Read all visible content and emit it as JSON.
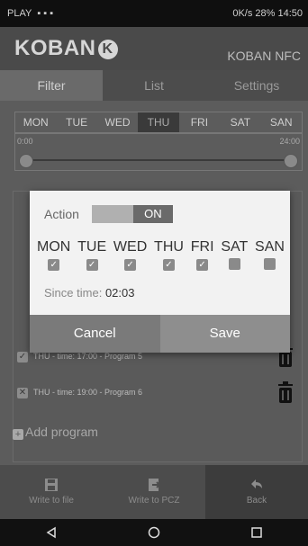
{
  "status": {
    "left_text": "PLAY",
    "right_text": "0K/s  28%  14:50"
  },
  "header": {
    "logo": "KOBAN",
    "logo_mark": "K",
    "brand": "KOBAN NFC"
  },
  "tabs": [
    {
      "label": "Filter"
    },
    {
      "label": "List"
    },
    {
      "label": "Settings"
    }
  ],
  "background": {
    "days": [
      "MON",
      "TUE",
      "WED",
      "THU",
      "FRI",
      "SAT",
      "SAN"
    ],
    "selected_day": "THU",
    "slider": {
      "start": "0:00",
      "end": "24:00"
    },
    "rows": [
      {
        "text": "THU - time: 17:00 - Program 5"
      },
      {
        "text": "THU - time: 19:00 - Program 6"
      }
    ],
    "add_program": "Add program"
  },
  "toolbar": {
    "write_file": "Write to file",
    "write_pcz": "Write to PCZ",
    "back": "Back"
  },
  "dialog": {
    "action_label": "Action",
    "toggle_value": "ON",
    "days": [
      {
        "name": "MON",
        "checked": true
      },
      {
        "name": "TUE",
        "checked": true
      },
      {
        "name": "WED",
        "checked": true
      },
      {
        "name": "THU",
        "checked": true
      },
      {
        "name": "FRI",
        "checked": true
      },
      {
        "name": "SAT",
        "checked": false
      },
      {
        "name": "SAN",
        "checked": false
      }
    ],
    "since_label": "Since time:",
    "since_value": "02:03",
    "cancel_label": "Cancel",
    "save_label": "Save"
  },
  "colors": {
    "dialog_bg": "#f2f2f2",
    "button_dark": "#7a7a7a",
    "button_save": "#8e8e8e"
  }
}
